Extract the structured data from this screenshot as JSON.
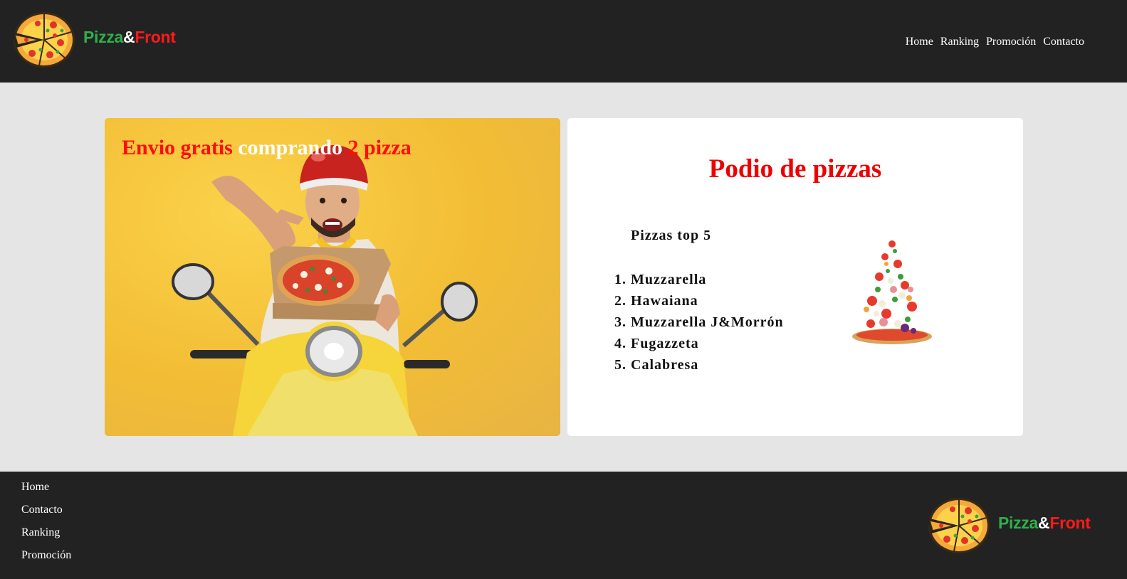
{
  "brand": {
    "name_part1": "Pizza",
    "name_amp": "&",
    "name_part2": "Front",
    "logo_icon": "pizza-logo-icon",
    "colors": {
      "green": "#2fb04a",
      "red": "#ff1a1a",
      "dark_bg": "#222222"
    }
  },
  "nav": {
    "items": [
      "Home",
      "Ranking",
      "Promoción",
      "Contacto"
    ]
  },
  "promo": {
    "title_red1": "Envio gratis",
    "title_white": "comprando",
    "title_red2": "2 pizza",
    "image": "delivery-man-on-scooter-with-pizza"
  },
  "podium": {
    "title": "Podio de pizzas",
    "subtitle": "Pizzas top 5",
    "items": [
      {
        "num": "1.",
        "label": "Muzzarella"
      },
      {
        "num": "2.",
        "label": "Hawaiana"
      },
      {
        "num": "3.",
        "label": "Muzzarella J&Morrón"
      },
      {
        "num": "4.",
        "label": "Fugazzeta"
      },
      {
        "num": "5.",
        "label": "Calabresa"
      }
    ],
    "image": "flying-pizza-ingredients"
  },
  "footer": {
    "links": [
      "Home",
      "Contacto",
      "Ranking",
      "Promoción"
    ]
  }
}
